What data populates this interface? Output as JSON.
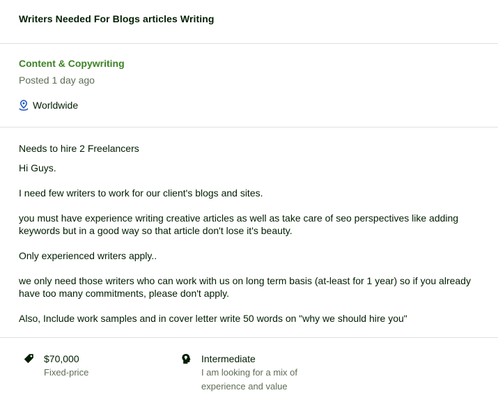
{
  "job": {
    "title": "Writers Needed For Blogs articles Writing",
    "category": "Content & Copywriting",
    "posted": "Posted 1 day ago",
    "location": "Worldwide",
    "needs": "Needs to hire 2 Freelancers",
    "description": [
      "Hi Guys.",
      "I need few writers to work for our client's blogs and sites.",
      "you must have experience writing creative articles as well as take care of seo perspectives like adding keywords but in a good way so that article don't lose it's beauty.",
      "Only experienced writers apply..",
      "we only need those writers who can work with us on long term basis (at-least for 1 year) so if you already have too many commitments, please don't apply.",
      "Also, Include work samples and in cover letter write 50 words on \"why we should hire you\""
    ],
    "budget": {
      "amount": "$70,000",
      "type": "Fixed-price",
      "icon": "price-tag-icon"
    },
    "experience": {
      "level": "Intermediate",
      "description": "I am looking for a mix of experience and value",
      "icon": "head-bulb-icon"
    },
    "location_icon": "location-pin-icon"
  },
  "colors": {
    "category": "#3c8224",
    "icon_blue": "#1f57c3",
    "text": "#001e00",
    "muted": "#5e6d55",
    "divider": "#e0e0e0"
  }
}
